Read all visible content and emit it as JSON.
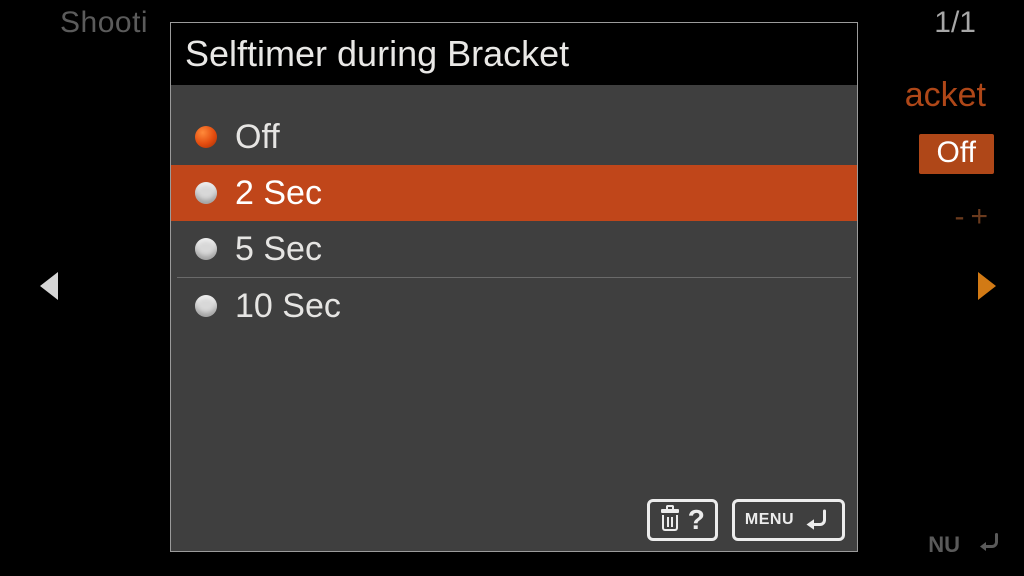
{
  "background": {
    "breadcrumb_fragment": "Shooti",
    "page_indicator": "1/1",
    "right_fragment": "acket",
    "value_badge": "Off",
    "plus_fragment": "-+",
    "menu_fragment": "NU"
  },
  "dialog": {
    "title": "Selftimer during Bracket",
    "current_index": 0,
    "highlight_index": 1,
    "options": [
      {
        "label": "Off"
      },
      {
        "label": "2 Sec"
      },
      {
        "label": "5 Sec"
      },
      {
        "label": "10 Sec"
      }
    ],
    "footer": {
      "help_symbol": "?",
      "menu_label": "MENU"
    }
  }
}
